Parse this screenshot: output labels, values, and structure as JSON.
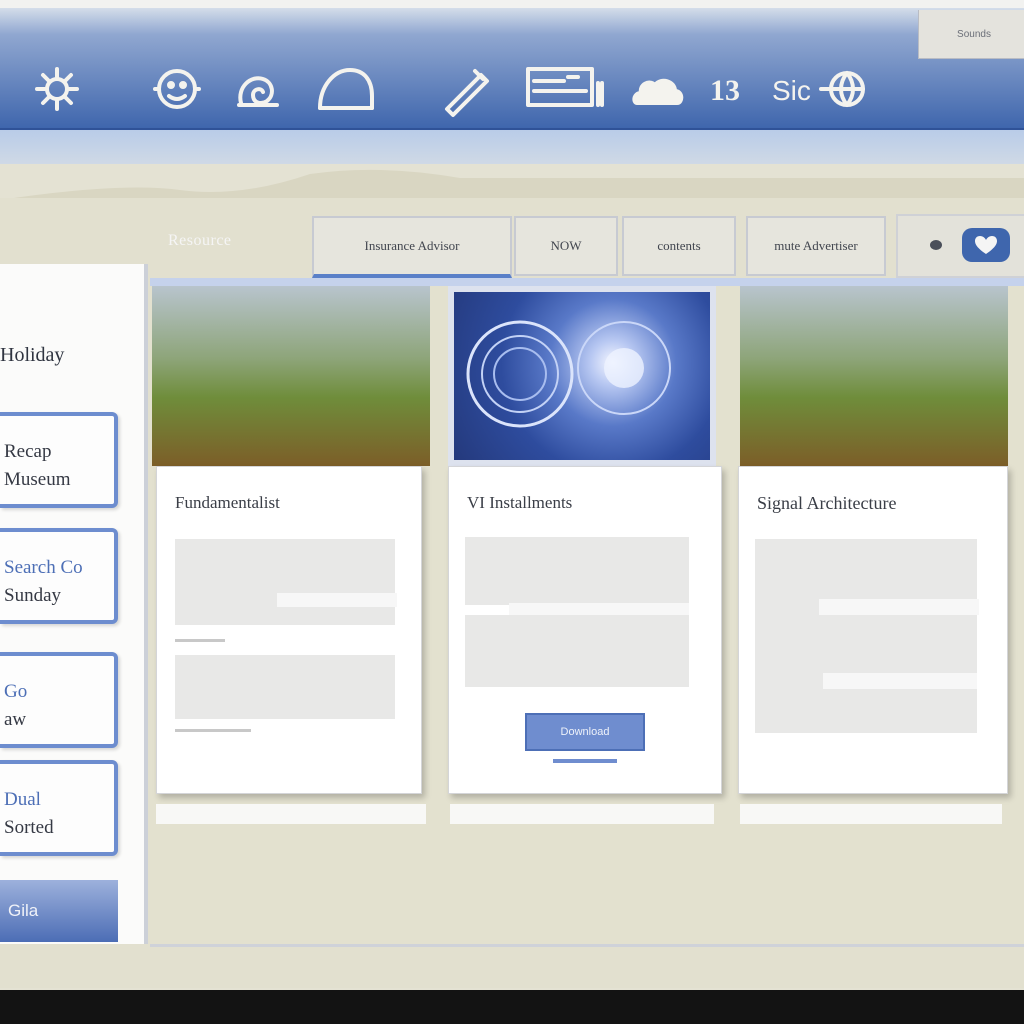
{
  "window": {
    "corner_label": "Sounds"
  },
  "toolbar": {
    "items": [
      {
        "icon": "settings-icon"
      },
      {
        "icon": "user-icon"
      },
      {
        "icon": "snail-icon"
      },
      {
        "icon": "helmet-icon"
      },
      {
        "icon": "pen-icon"
      },
      {
        "icon": "printer-icon"
      },
      {
        "icon": "cloud-icon"
      },
      {
        "text": "13"
      },
      {
        "text": "Sic",
        "icon": "globe-icon"
      }
    ]
  },
  "tabbar": {
    "label": "Resource",
    "tabs": [
      "Insurance Advisor",
      "NOW",
      "contents",
      "mute Advertiser"
    ],
    "right_icon": "heart-icon"
  },
  "sidebar": {
    "title": "Holiday",
    "buttons": [
      {
        "line1": "Recap",
        "line2": "Museum"
      },
      {
        "line1": "Search Co",
        "line2": "Sunday"
      },
      {
        "line1": "Go",
        "line2": "aw"
      },
      {
        "line1": "Dual",
        "line2": "Sorted"
      }
    ],
    "footer": "Gila"
  },
  "cards": [
    {
      "title": "Fundamentalist",
      "hero": "landscape"
    },
    {
      "title": "VI Installments",
      "hero": "space",
      "button_label": "Download"
    },
    {
      "title": "Signal Architecture",
      "hero": "landscape"
    }
  ],
  "colors": {
    "toolbar_dark": "#3f66ad",
    "accent": "#6d8dcf",
    "background": "#e4e2d3",
    "card": "#ffffff"
  }
}
